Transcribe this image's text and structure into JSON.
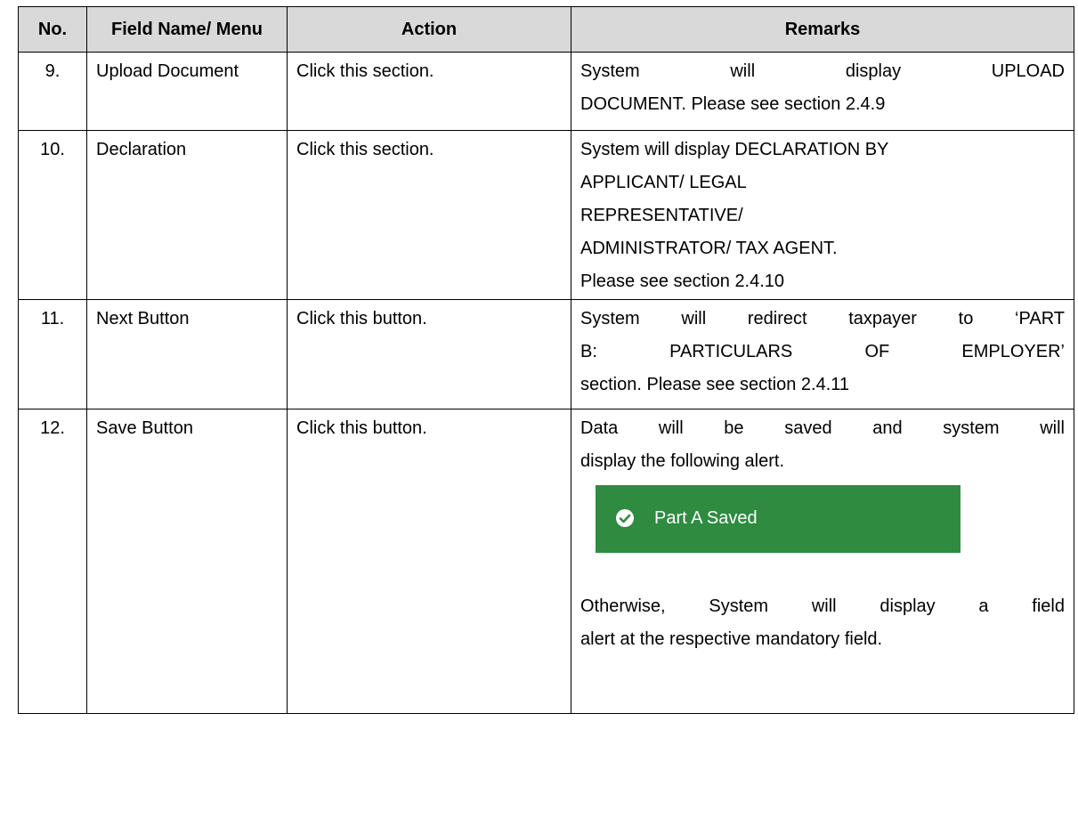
{
  "table": {
    "headers": [
      "No.",
      "Field Name/ Menu",
      "Action",
      "Remarks"
    ],
    "rows": [
      {
        "no": "9.",
        "field": "Upload Document",
        "action": "Click this section.",
        "remarks_lines": [
          "System will display UPLOAD",
          "DOCUMENT. Please see section 2.4.9"
        ]
      },
      {
        "no": "10.",
        "field": "Declaration",
        "action": "Click this section.",
        "remarks_lines": [
          "System will display DECLARATION BY",
          "APPLICANT/ LEGAL",
          "REPRESENTATIVE/",
          "ADMINISTRATOR/ TAX AGENT.",
          "Please see section 2.4.10"
        ]
      },
      {
        "no": "11.",
        "field": "Next Button",
        "action": "Click this button.",
        "remarks_lines": [
          "System will redirect taxpayer to ‘PART",
          "B: PARTICULARS OF EMPLOYER’",
          "section. Please see section 2.4.11"
        ]
      },
      {
        "no": "12.",
        "field": "Save Button",
        "action": "Click this button.",
        "remarks_lines": [
          "Data will be saved and system will",
          "display the following alert."
        ],
        "alert": {
          "text": "Part A Saved",
          "icon": "check-circle-icon",
          "background": "#2e8b40",
          "text_color": "#ffffff"
        },
        "remarks_after_lines": [
          "Otherwise, System will display a field",
          "alert at the respective mandatory field."
        ]
      }
    ]
  },
  "colors": {
    "header_bg": "#d9d9d9",
    "border": "#000000"
  }
}
